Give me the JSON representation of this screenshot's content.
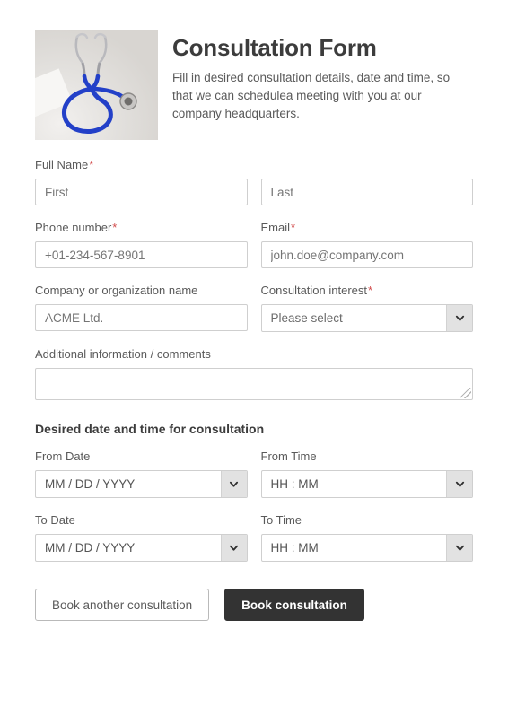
{
  "header": {
    "title": "Consultation Form",
    "description": "Fill in desired consultation details, date and time, so that we can schedulea meeting with you at our company headquarters.",
    "image_alt": "stethoscope-photo"
  },
  "form": {
    "full_name": {
      "label": "Full Name",
      "required_mark": "*",
      "first": {
        "placeholder": "First",
        "value": ""
      },
      "last": {
        "placeholder": "Last",
        "value": ""
      }
    },
    "phone": {
      "label": "Phone number",
      "required_mark": "*",
      "placeholder": "+01-234-567-8901",
      "value": ""
    },
    "email": {
      "label": "Email",
      "required_mark": "*",
      "placeholder": "john.doe@company.com",
      "value": ""
    },
    "company": {
      "label": "Company or organization name",
      "placeholder": "ACME Ltd.",
      "value": ""
    },
    "interest": {
      "label": "Consultation interest",
      "required_mark": "*",
      "selected": "Please select"
    },
    "comments": {
      "label": "Additional information / comments",
      "value": ""
    }
  },
  "schedule": {
    "heading": "Desired date and time for consultation",
    "from_date": {
      "label": "From Date",
      "value": "MM / DD / YYYY"
    },
    "from_time": {
      "label": "From Time",
      "value": "HH : MM"
    },
    "to_date": {
      "label": "To Date",
      "value": "MM / DD / YYYY"
    },
    "to_time": {
      "label": "To Time",
      "value": "HH : MM"
    }
  },
  "actions": {
    "secondary_label": "Book another consultation",
    "primary_label": "Book consultation"
  },
  "colors": {
    "primary_button_bg": "#333333",
    "required_asterisk": "#d24b4b",
    "border": "#cfcfcf",
    "select_arrow_bg": "#e2e2e2",
    "heading_text": "#3c3c3c",
    "label_text": "#5a5a5a",
    "placeholder_text": "#9b9b9b"
  },
  "icons": {
    "chevron_down": "chevron-down-icon",
    "resize_handle": "resize-grip-icon"
  }
}
